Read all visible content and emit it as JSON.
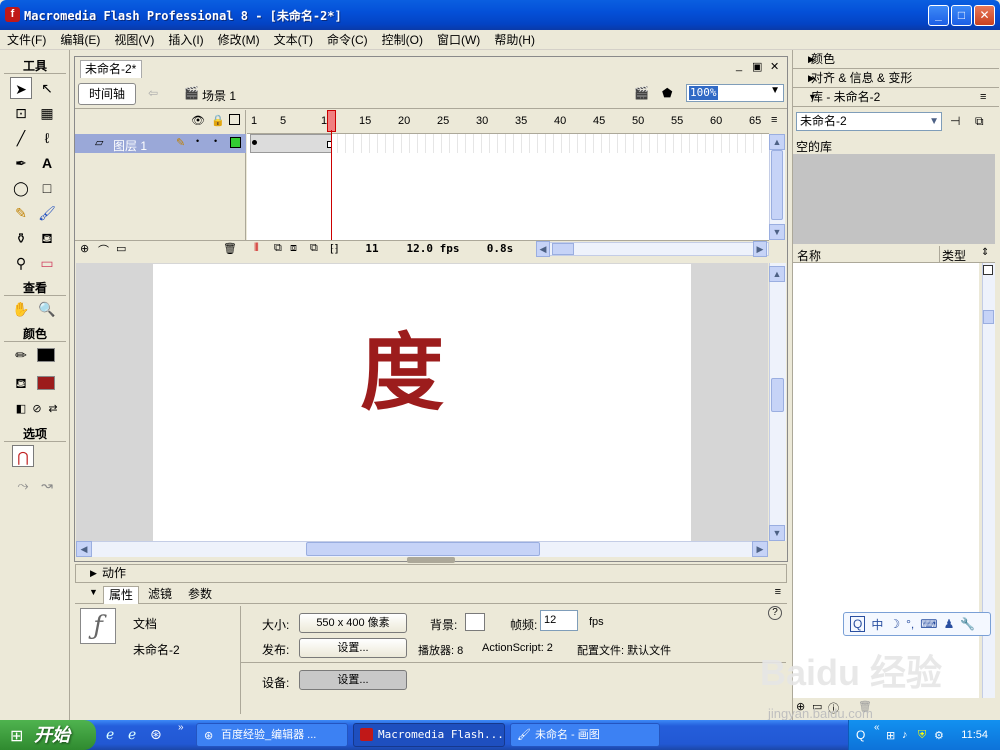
{
  "window": {
    "title": "Macromedia Flash Professional 8 - [未命名-2*]",
    "app_icon": "flash-icon"
  },
  "menu": [
    "文件(F)",
    "编辑(E)",
    "视图(V)",
    "插入(I)",
    "修改(M)",
    "文本(T)",
    "命令(C)",
    "控制(O)",
    "窗口(W)",
    "帮助(H)"
  ],
  "tools": {
    "header": "工具",
    "view_header": "查看",
    "color_header": "颜色",
    "options_header": "选项"
  },
  "document": {
    "tab": "未命名-2*",
    "timeline_button": "时间轴",
    "scene": "场景 1",
    "zoom": "100%"
  },
  "timeline": {
    "layer_name": "图层 1",
    "ruler": [
      "1",
      "5",
      "10",
      "15",
      "20",
      "25",
      "30",
      "35",
      "40",
      "45",
      "50",
      "55",
      "60",
      "65"
    ],
    "current_frame": "11",
    "fps": "12.0 fps",
    "time": "0.8s"
  },
  "stage": {
    "glyph": "度",
    "glyph_color": "#9c1c1c"
  },
  "panels": {
    "actions": "动作",
    "tabs": [
      "属性",
      "滤镜",
      "参数"
    ],
    "doc_label": "文档",
    "doc_name": "未命名-2",
    "size_label": "大小:",
    "size_value": "550 x 400 像素",
    "bg_label": "背景:",
    "fps_label": "帧频:",
    "fps_value": "12",
    "fps_unit": "fps",
    "publish_label": "发布:",
    "settings_button": "设置...",
    "player_label": "播放器: 8",
    "actionscript_label": "ActionScript: 2",
    "profile_label": "配置文件: 默认文件",
    "device_label": "设备:"
  },
  "right": {
    "color_panel": "颜色",
    "align_panel": "对齐 & 信息 & 变形",
    "library_panel": "库 - 未命名-2",
    "library_select": "未命名-2",
    "empty_library": "空的库",
    "col_name": "名称",
    "col_type": "类型"
  },
  "ime": [
    "中",
    "☽",
    "°,",
    "⌨",
    "♟",
    "🔧"
  ],
  "taskbar": {
    "start": "开始",
    "tasks": [
      "百度经验_编辑器 ...",
      "Macromedia Flash...",
      "未命名 - 画图"
    ],
    "clock": "11:54"
  },
  "watermark": {
    "text": "Baidu 经验",
    "url": "jingyan.baidu.com"
  }
}
